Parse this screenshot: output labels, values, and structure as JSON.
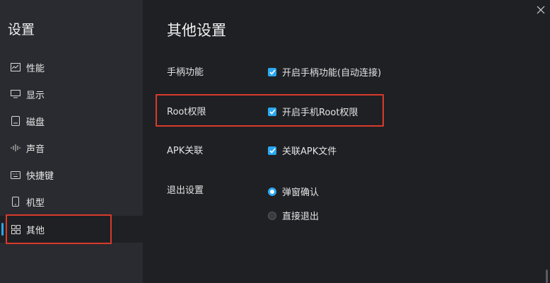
{
  "sidebar": {
    "title": "设置",
    "items": [
      {
        "label": "性能",
        "icon": "performance-chart-icon"
      },
      {
        "label": "显示",
        "icon": "monitor-icon"
      },
      {
        "label": "磁盘",
        "icon": "disk-icon"
      },
      {
        "label": "声音",
        "icon": "sound-wave-icon"
      },
      {
        "label": "快捷键",
        "icon": "keyboard-icon"
      },
      {
        "label": "机型",
        "icon": "phone-icon"
      },
      {
        "label": "其他",
        "icon": "grid-icon",
        "active": true
      }
    ]
  },
  "main": {
    "title": "其他设置",
    "gamepad": {
      "label": "手柄功能",
      "option": "开启手柄功能(自动连接)",
      "checked": true
    },
    "root": {
      "label": "Root权限",
      "option": "开启手机Root权限",
      "checked": true
    },
    "apk": {
      "label": "APK关联",
      "option": "关联APK文件",
      "checked": true
    },
    "exit": {
      "label": "退出设置",
      "options": [
        {
          "label": "弹窗确认",
          "selected": true
        },
        {
          "label": "直接退出",
          "selected": false
        }
      ]
    }
  },
  "colors": {
    "accent": "#2aa7f0",
    "highlight": "#d93a2b",
    "sidebar_bg": "#2a2b30",
    "main_bg": "#1f2024"
  }
}
